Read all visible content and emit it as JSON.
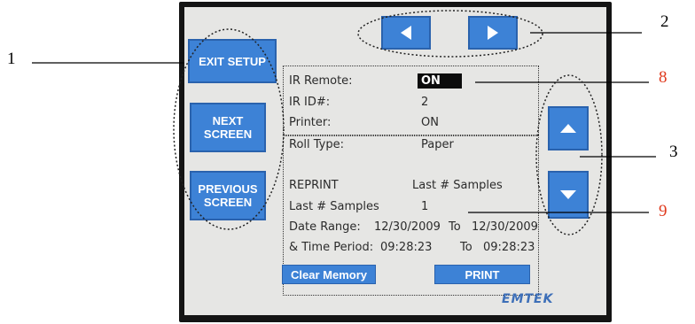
{
  "buttons": {
    "exit_setup": "EXIT SETUP",
    "next_screen": "NEXT\nSCREEN",
    "previous_screen": "PREVIOUS\nSCREEN",
    "clear_memory": "Clear Memory",
    "print": "PRINT"
  },
  "settings": {
    "ir_remote_label": "IR Remote:",
    "ir_remote_value": "ON",
    "ir_id_label": "IR ID#:",
    "ir_id_value": "2",
    "printer_label": "Printer:",
    "printer_value": "ON",
    "roll_type_label": "Roll Type:",
    "roll_type_value": "Paper"
  },
  "reprint": {
    "reprint_label": "REPRINT",
    "reprint_mode": "Last # Samples",
    "last_samples_label": "Last # Samples",
    "last_samples_value": "1",
    "date_range_label": "Date Range:",
    "date_from": "12/30/2009",
    "to_1": "To",
    "date_to": "12/30/2009",
    "time_period_label": "& Time Period:",
    "time_from": "09:28:23",
    "to_2": "To",
    "time_to": "09:28:23"
  },
  "logo": "EMTEK",
  "callouts": {
    "c1": "1",
    "c2": "2",
    "c3": "3",
    "c8": "8",
    "c9": "9"
  },
  "colors": {
    "button_blue": "#3d82d6",
    "callout_red": "#e03a1e",
    "bezel": "#141414",
    "screen_bg": "#e6e6e4"
  },
  "icons": [
    "arrow-left-icon",
    "arrow-right-icon",
    "arrow-up-icon",
    "arrow-down-icon"
  ]
}
